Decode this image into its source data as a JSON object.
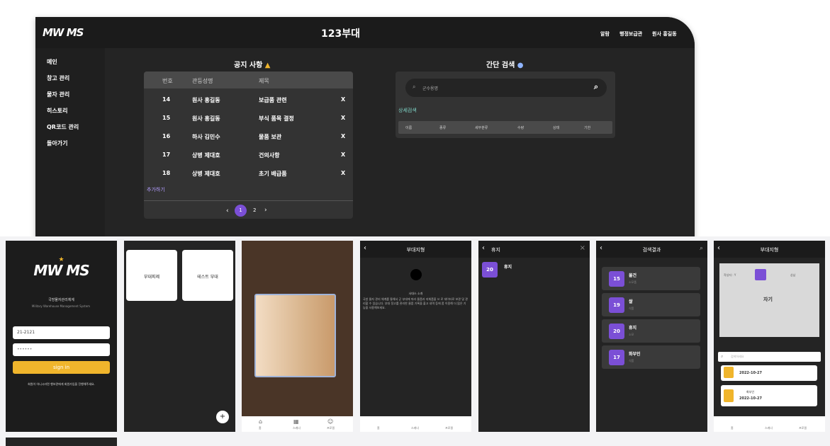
{
  "desktop": {
    "logo": "MW MS",
    "brand": "123부대",
    "topnav": [
      "알람",
      "행정보급관",
      "원사 홍길동"
    ],
    "sidebar": [
      "메인",
      "창고 관리",
      "물자 관리",
      "히스토리",
      "QR코드 관리",
      "돌아가기"
    ],
    "notice": {
      "title": "공지 사항",
      "columns": [
        "번호",
        "관등성명",
        "제목"
      ],
      "rows": [
        {
          "no": "14",
          "name": "원사 홍길동",
          "subject": "보급품 관련",
          "del": "X"
        },
        {
          "no": "15",
          "name": "원사 홍길동",
          "subject": "부식 품목 결정",
          "del": "X"
        },
        {
          "no": "16",
          "name": "하사 김민수",
          "subject": "물품 보관",
          "del": "X"
        },
        {
          "no": "17",
          "name": "상병 제대호",
          "subject": "건의사항",
          "del": "X"
        },
        {
          "no": "18",
          "name": "상병 제대호",
          "subject": "초기 배급품",
          "del": "X"
        }
      ],
      "add_more": "추가하기",
      "pagination": {
        "prev": "‹",
        "pages": [
          "1",
          "2"
        ],
        "next": "›",
        "current": "1"
      }
    },
    "quick_search": {
      "title": "간단 검색",
      "placeholder": "군수용명",
      "detail_link": "상세검색",
      "columns": [
        "이름",
        "종류",
        "세부분류",
        "수량",
        "상태",
        "기한"
      ]
    }
  },
  "phone_login": {
    "logo": "MW MS",
    "subtitle": "국방물자관리체계",
    "subtitle_en": "Military Warehouse Management System",
    "id_value": "21-2121",
    "pw_value": "••••••",
    "signin": "sign in",
    "signup_note": "회원이 아니시라면 행보관에게 회원가입을 진행해주세요."
  },
  "phone_units": {
    "tiles": [
      "부대피제",
      "테스트 부대"
    ],
    "fab": "+"
  },
  "phone_scanner": {
    "nav": [
      "홈",
      "스캐너",
      "프로필"
    ]
  },
  "phone_unit_info": {
    "title": "부대지형",
    "header": "사대스 소개",
    "body": "국방 물자 관리 체계를 통해서 군 부대에 따라 물품과 지체품을 쓰 로 데이터로 보관 및 관리할 수 있습니다. 부대 정고를 관리한 물품 기록을 출고 내역 등에 폼 이용해 더 많은 기능을 사용해보세요.",
    "nav": [
      "홈",
      "스캐너",
      "프로필"
    ]
  },
  "phone_item": {
    "title": "휴지",
    "badge": "20",
    "name": "휴지",
    "close": "×"
  },
  "phone_search": {
    "title": "검색결과",
    "results": [
      {
        "qty": "15",
        "name": "물건",
        "sub": "소모품"
      },
      {
        "qty": "19",
        "name": "쌀",
        "sub": "식품"
      },
      {
        "qty": "20",
        "name": "휴지",
        "sub": "소모"
      },
      {
        "qty": "17",
        "name": "화부인",
        "sub": "식품"
      }
    ]
  },
  "phone_map": {
    "title": "부대지형",
    "legend_left": "작성자 : Y",
    "legend_right": "상남",
    "room": "자기",
    "search_placeholder": "검색하세요",
    "entries": [
      {
        "name": "",
        "date": "2022-10-27"
      },
      {
        "name": "화부인",
        "date": "2022-10-27"
      }
    ],
    "nav": [
      "홈",
      "스캐너",
      "프로필"
    ]
  },
  "colors": {
    "accent": "#7b4fd6",
    "yellow": "#f0b52c",
    "dark": "#242424"
  }
}
